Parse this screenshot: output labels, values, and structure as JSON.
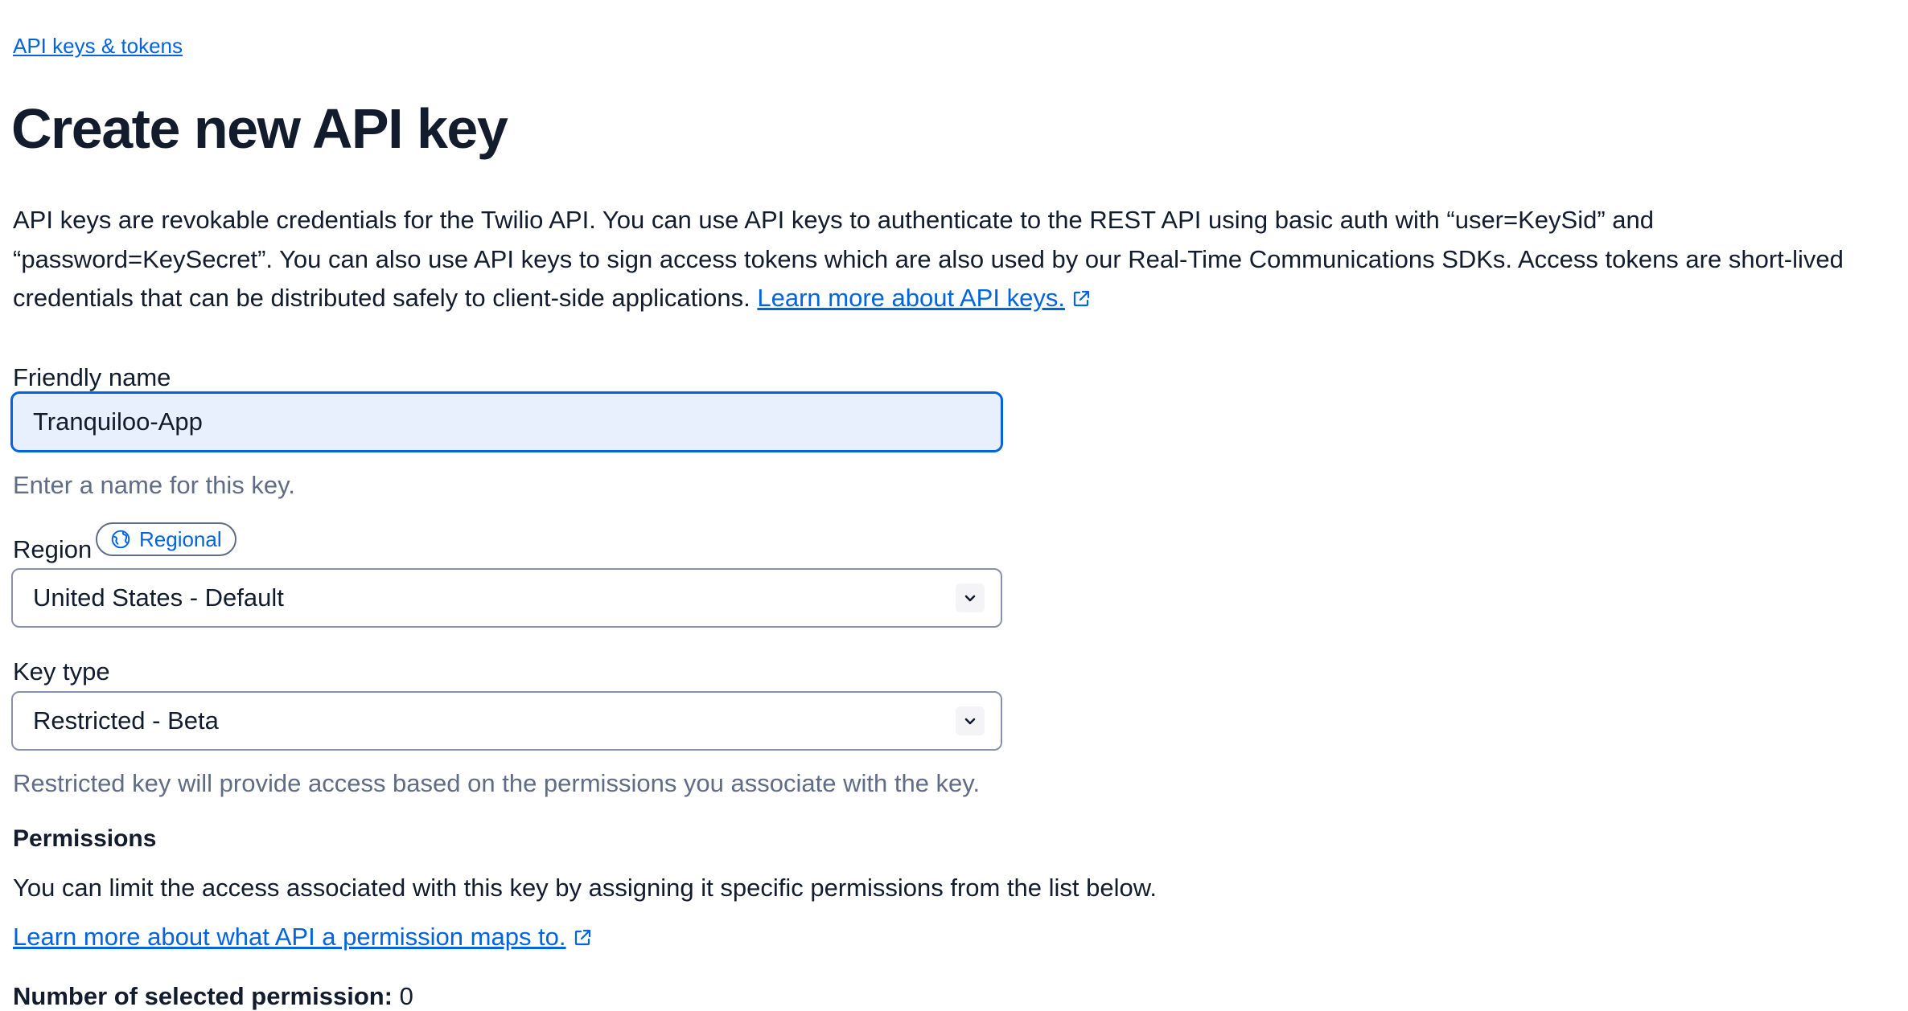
{
  "breadcrumb": {
    "label": "API keys & tokens"
  },
  "page": {
    "title": "Create new API key"
  },
  "intro": {
    "text": "API keys are revokable credentials for the Twilio API. You can use API keys to authenticate to the REST API using basic auth with “user=KeySid” and “password=KeySecret”. You can also use API keys to sign access tokens which are also used by our Real-Time Communications SDKs. Access tokens are short-lived credentials that can be distributed safely to client-side applications.",
    "link_label": "Learn more about API keys."
  },
  "friendly_name": {
    "label": "Friendly name",
    "value": "Tranquiloo-App",
    "help": "Enter a name for this key."
  },
  "region": {
    "label": "Region",
    "badge": "Regional",
    "selected": "United States - Default"
  },
  "key_type": {
    "label": "Key type",
    "selected": "Restricted - Beta",
    "help": "Restricted key will provide access based on the permissions you associate with the key."
  },
  "permissions": {
    "heading": "Permissions",
    "description": "You can limit the access associated with this key by assigning it specific permissions from the list below.",
    "link_label": "Learn more about what API a permission maps to.",
    "count_label": "Number of selected permission:",
    "count_value": "0"
  },
  "colors": {
    "link": "#0263e0",
    "text": "#121c2d",
    "muted": "#606b85",
    "input_focus_bg": "#e8f0fd"
  },
  "icons": {
    "external_link": "external-link-icon",
    "globe": "globe-icon",
    "chevron": "chevron-down-icon"
  }
}
